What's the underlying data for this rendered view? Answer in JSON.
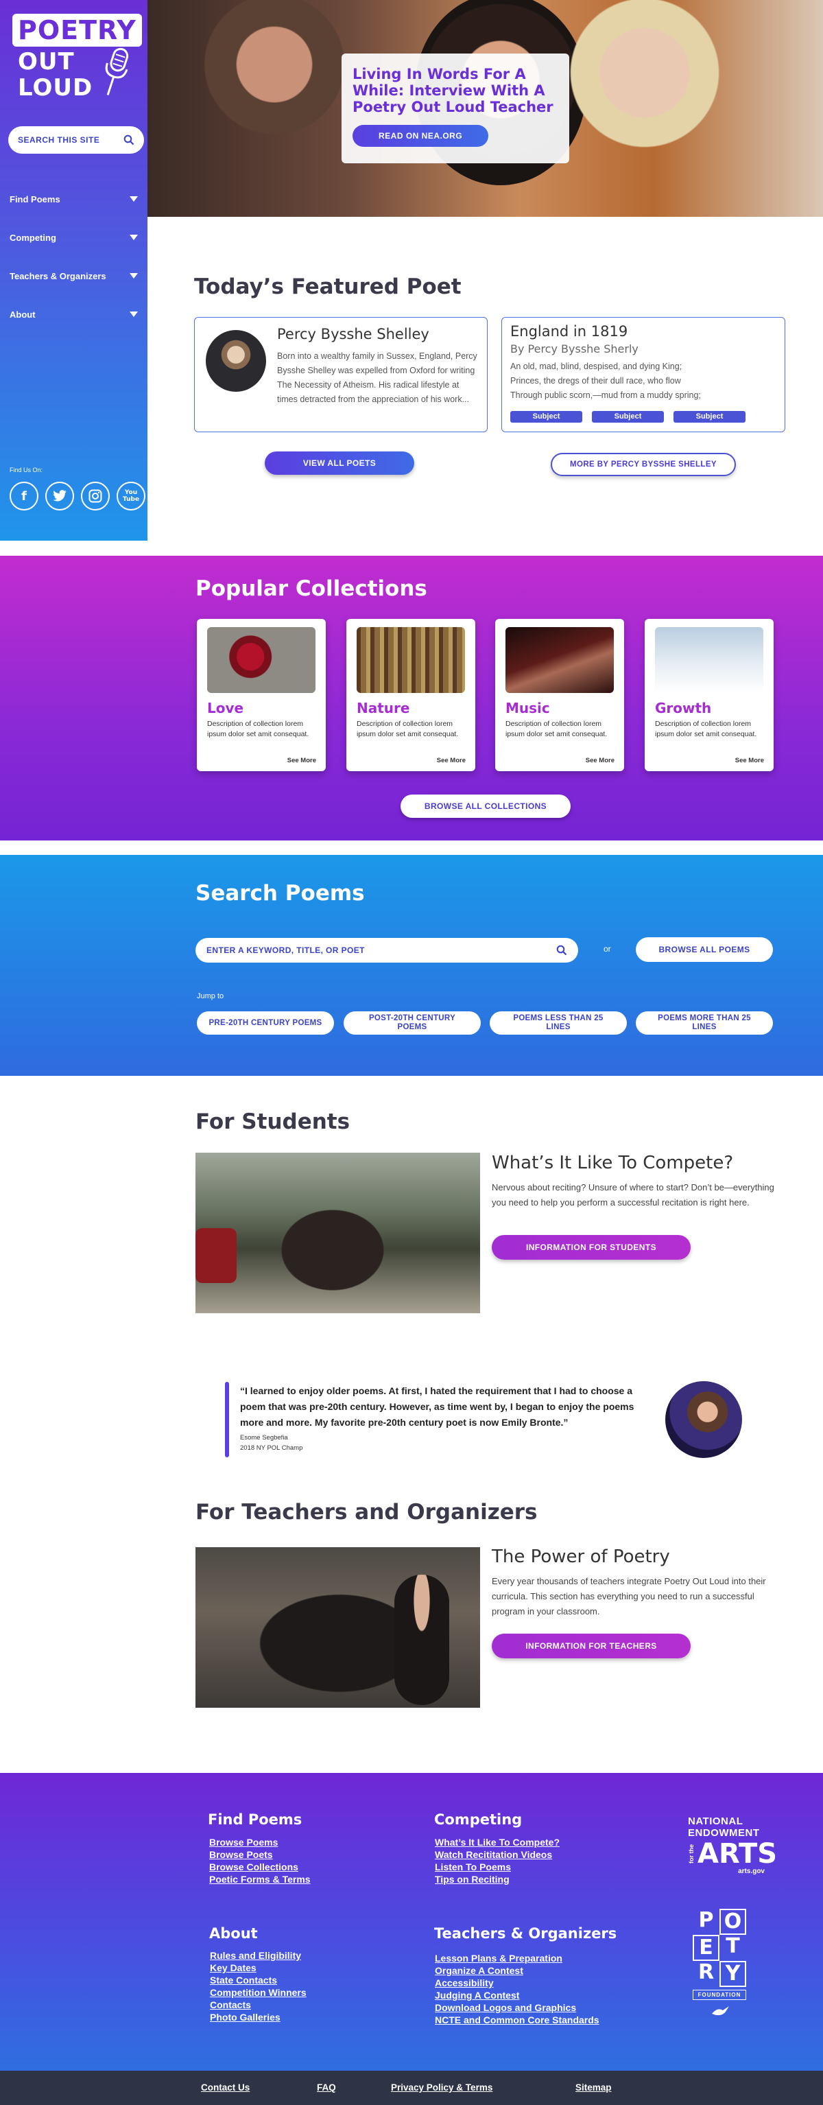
{
  "sidebar": {
    "logo": {
      "line1": "POETRY",
      "line2": "OUT",
      "line3": "LOUD"
    },
    "search_label": "SEARCH THIS SITE",
    "nav": [
      {
        "label": "Find Poems"
      },
      {
        "label": "Competing"
      },
      {
        "label": "Teachers & Organizers"
      },
      {
        "label": "About"
      }
    ],
    "find_us": "Find Us On:",
    "socials": [
      {
        "icon": "facebook-icon",
        "glyph": "f"
      },
      {
        "icon": "twitter-icon",
        "glyph": "t"
      },
      {
        "icon": "instagram-icon",
        "glyph": "◎"
      },
      {
        "icon": "youtube-icon",
        "glyph": "You Tube"
      }
    ]
  },
  "hero": {
    "title": "Living In Words For A While: Interview With A Poetry Out Loud Teacher",
    "button": "READ ON NEA.ORG"
  },
  "featured": {
    "heading": "Today’s Featured Poet",
    "poet_name": "Percy Bysshe Shelley",
    "poet_bio": "Born into a wealthy family in Sussex, England, Percy Bysshe Shelley was expelled from Oxford for writing The Necessity of Atheism. His radical lifestyle at times detracted from the appreciation of his work...",
    "poem_title": "England in 1819",
    "poem_author": "By Percy Bysshe Sherly",
    "poem_lines": [
      "An old, mad, blind, despised, and dying King;",
      "Princes, the dregs of their dull race, who flow",
      "Through public scorn,—mud from a muddy spring;"
    ],
    "subjects": [
      "Subject",
      "Subject",
      "Subject"
    ],
    "view_all_button": "VIEW ALL POETS",
    "more_by_button": "MORE BY PERCY BYSSHE SHELLEY"
  },
  "collections": {
    "heading": "Popular Collections",
    "items": [
      {
        "name": "Love",
        "description": "Description of collection lorem ipsum dolor set amit consequat.",
        "more": "See More"
      },
      {
        "name": "Nature",
        "description": "Description of collection lorem ipsum dolor set amit consequat.",
        "more": "See More"
      },
      {
        "name": "Music",
        "description": "Description of collection lorem ipsum dolor set amit consequat.",
        "more": "See More"
      },
      {
        "name": "Growth",
        "description": "Description of collection lorem ipsum dolor set amit consequat.",
        "more": "See More"
      }
    ],
    "browse_button": "BROWSE ALL COLLECTIONS"
  },
  "search_poems": {
    "heading": "Search Poems",
    "placeholder": "ENTER A KEYWORD, TITLE, OR POET",
    "or": "or",
    "browse_button": "BROWSE ALL POEMS",
    "jump_to": "Jump to",
    "jump_links": [
      "PRE-20TH CENTURY POEMS",
      "POST-20TH CENTURY POEMS",
      "POEMS LESS THAN 25 LINES",
      "POEMS MORE THAN 25 LINES"
    ]
  },
  "students": {
    "heading": "For Students",
    "title": "What’s It Like To Compete?",
    "body": "Nervous about reciting? Unsure of where to start? Don’t be—everything you need to help you perform a successful recitation is right here.",
    "button": "INFORMATION FOR STUDENTS"
  },
  "quote": {
    "text": "“I learned to enjoy older poems. At first, I hated the requirement that I had to choose a poem that was pre-20th century. However, as time went by, I began to enjoy the poems more and more. My favorite pre-20th century poet is now Emily Bronte.”",
    "name": "Esome Segbefia",
    "role": "2018 NY POL Champ"
  },
  "teachers": {
    "heading": "For Teachers and Organizers",
    "title": "The Power of Poetry",
    "body": "Every year thousands of teachers integrate Poetry Out Loud into their curricula. This section has everything you need to run a successful program in your classroom.",
    "button": "INFORMATION FOR TEACHERS"
  },
  "footer": {
    "find_poems": {
      "heading": "Find Poems",
      "links": [
        "Browse Poems",
        "Browse Poets",
        "Browse Collections",
        "Poetic Forms & Terms"
      ]
    },
    "competing": {
      "heading": "Competing",
      "links": [
        "What’s It Like To Compete?",
        "Watch Recititation Videos",
        "Listen To Poems",
        "Tips on Reciting"
      ]
    },
    "about": {
      "heading": "About",
      "links": [
        "Rules and Eligibility",
        "Key Dates",
        "State Contacts",
        "Competition Winners",
        "Contacts",
        "Photo Galleries"
      ]
    },
    "teachers": {
      "heading": "Teachers & Organizers",
      "links": [
        "Lesson Plans & Preparation",
        "Organize A Contest",
        "Accessibility",
        "Judging A Contest",
        "Download Logos and Graphics",
        "NCTE and Common Core Standards"
      ]
    },
    "nea": {
      "line1": "NATIONAL",
      "line2": "ENDOWMENT",
      "for_the": "for the",
      "arts": "ARTS",
      "site": "arts.gov"
    },
    "poetry_foundation": {
      "letters": [
        "P",
        "O",
        "E",
        "T",
        "R",
        "Y"
      ],
      "label": "FOUNDATION"
    }
  },
  "bottom_bar": {
    "links": [
      "Contact Us",
      "FAQ",
      "Privacy Policy & Terms",
      "Sitemap"
    ]
  }
}
